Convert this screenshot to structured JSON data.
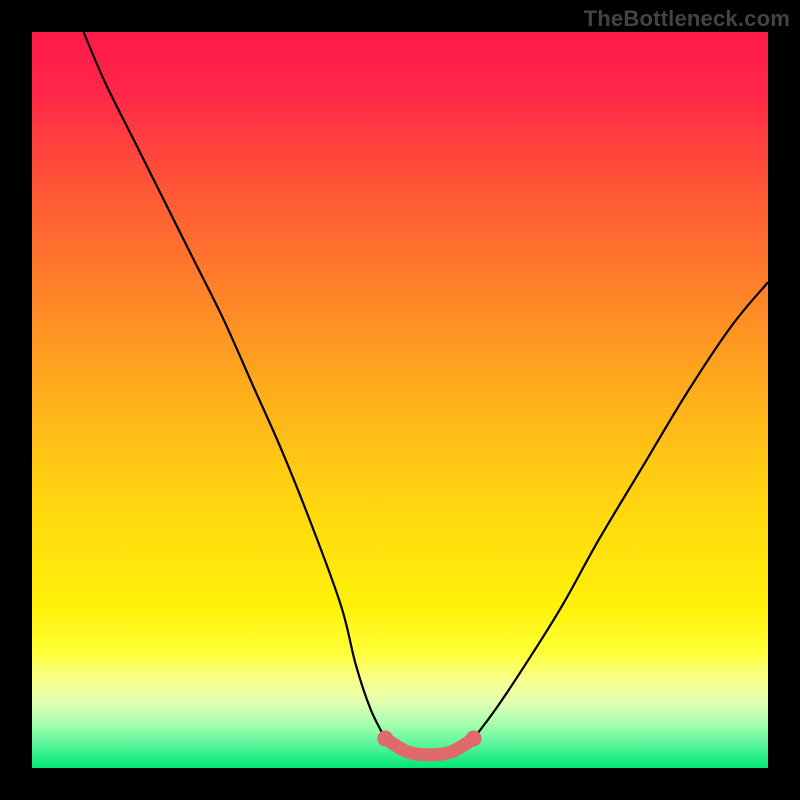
{
  "watermark": "TheBottleneck.com",
  "gradient": {
    "stops": [
      {
        "offset": 0.0,
        "color": "#ff1a4b"
      },
      {
        "offset": 0.08,
        "color": "#ff2648"
      },
      {
        "offset": 0.2,
        "color": "#ff5237"
      },
      {
        "offset": 0.35,
        "color": "#ff8228"
      },
      {
        "offset": 0.5,
        "color": "#ffb01b"
      },
      {
        "offset": 0.65,
        "color": "#ffd80f"
      },
      {
        "offset": 0.78,
        "color": "#fff109"
      },
      {
        "offset": 0.84,
        "color": "#ffff33"
      },
      {
        "offset": 0.88,
        "color": "#f8ff8a"
      },
      {
        "offset": 0.91,
        "color": "#e3ffb2"
      },
      {
        "offset": 0.94,
        "color": "#a7ffb0"
      },
      {
        "offset": 0.97,
        "color": "#55f59a"
      },
      {
        "offset": 1.0,
        "color": "#00e676"
      }
    ]
  },
  "chart_data": {
    "type": "line",
    "title": "",
    "xlabel": "",
    "ylabel": "",
    "xlim": [
      0,
      100
    ],
    "ylim": [
      0,
      100
    ],
    "grid": false,
    "curves": [
      {
        "name": "left-branch",
        "color": "#000000",
        "width": 2.2,
        "x": [
          7,
          10,
          14,
          18,
          22,
          26,
          30,
          34,
          38,
          42,
          44,
          46,
          48
        ],
        "y": [
          100,
          93,
          85,
          77,
          69,
          61,
          52,
          43,
          33,
          22,
          14,
          8,
          4
        ]
      },
      {
        "name": "right-branch",
        "color": "#000000",
        "width": 2.2,
        "x": [
          60,
          63,
          67,
          72,
          77,
          83,
          89,
          95,
          100
        ],
        "y": [
          4,
          8,
          14,
          22,
          31,
          41,
          51,
          60,
          66
        ]
      },
      {
        "name": "valley-floor",
        "color": "#e06a6a",
        "width": 13,
        "linecap": "round",
        "x": [
          48,
          51,
          54,
          57,
          60
        ],
        "y": [
          4,
          2.2,
          1.8,
          2.2,
          4
        ]
      }
    ],
    "endpoints": [
      {
        "x": 48,
        "y": 4,
        "r": 8,
        "color": "#e06a6a"
      },
      {
        "x": 60,
        "y": 4,
        "r": 8,
        "color": "#e06a6a"
      }
    ]
  }
}
